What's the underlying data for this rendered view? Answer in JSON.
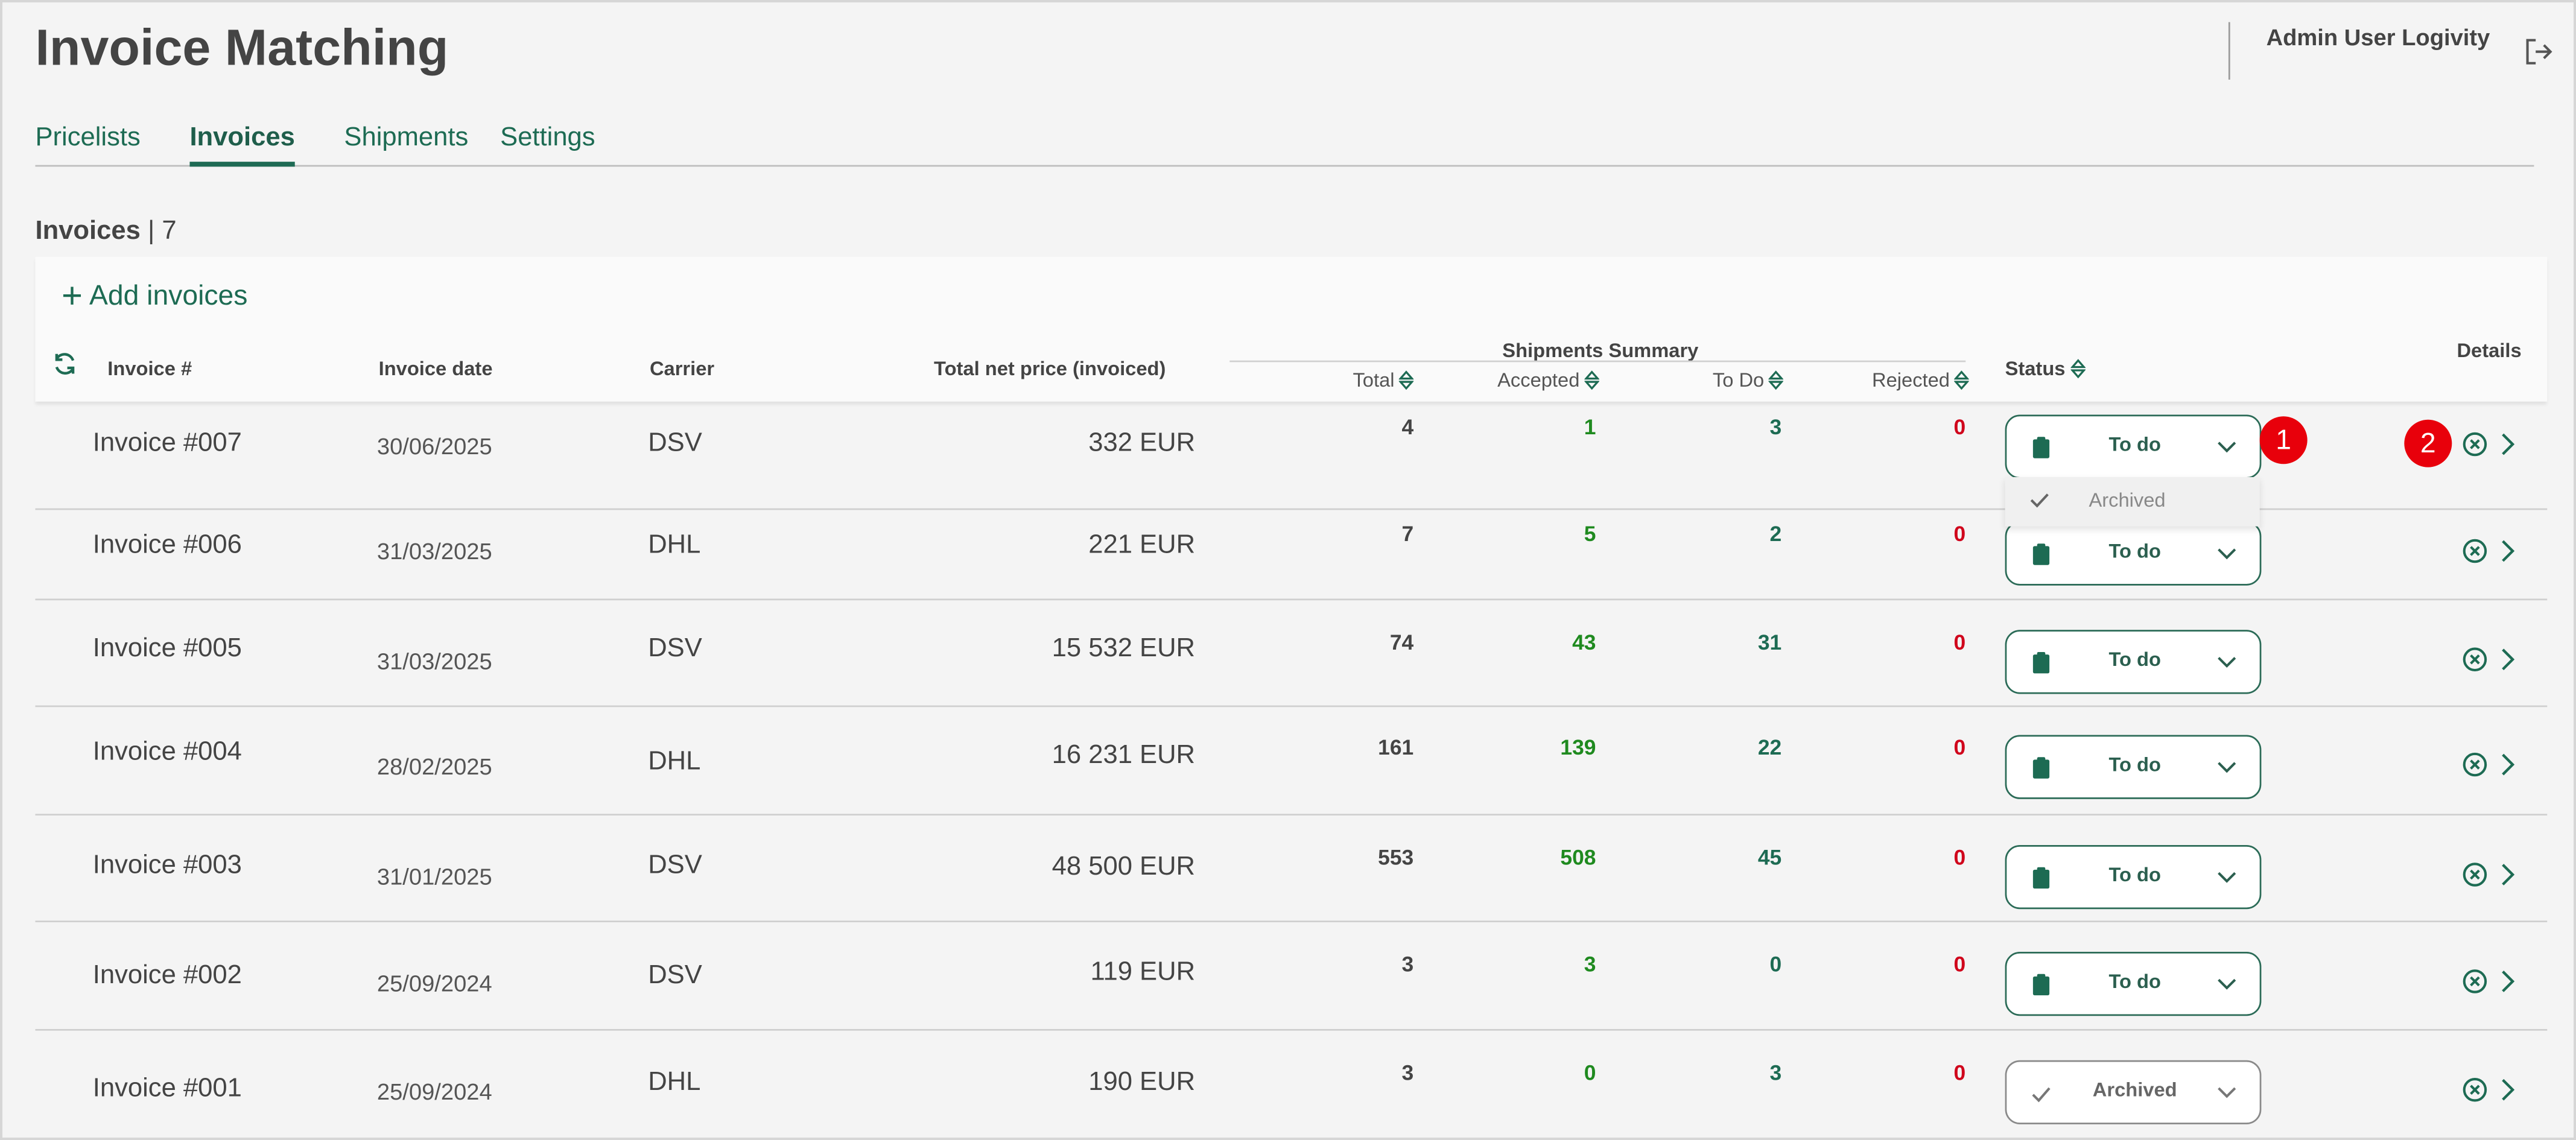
{
  "app": {
    "title": "Invoice Matching",
    "user_name": "Admin User Logivity"
  },
  "tabs": [
    {
      "label": "Pricelists",
      "active": false
    },
    {
      "label": "Invoices",
      "active": true
    },
    {
      "label": "Shipments",
      "active": false
    },
    {
      "label": "Settings",
      "active": false
    }
  ],
  "list": {
    "heading": "Invoices",
    "separator": "|",
    "count": "7",
    "add_label": "Add invoices"
  },
  "columns": {
    "invoice": "Invoice #",
    "date": "Invoice date",
    "carrier": "Carrier",
    "price": "Total net price (invoiced)",
    "summary": "Shipments Summary",
    "total": "Total",
    "accepted": "Accepted",
    "todo": "To Do",
    "rejected": "Rejected",
    "status": "Status",
    "details": "Details"
  },
  "rows": [
    {
      "invoice": "Invoice #007",
      "date": "30/06/2025",
      "carrier": "DSV",
      "price": "332 EUR",
      "total": "4",
      "accepted": "1",
      "todo": "3",
      "rejected": "0",
      "status": "To do"
    },
    {
      "invoice": "Invoice #006",
      "date": "31/03/2025",
      "carrier": "DHL",
      "price": "221 EUR",
      "total": "7",
      "accepted": "5",
      "todo": "2",
      "rejected": "0",
      "status": "To do"
    },
    {
      "invoice": "Invoice #005",
      "date": "31/03/2025",
      "carrier": "DSV",
      "price": "15 532 EUR",
      "total": "74",
      "accepted": "43",
      "todo": "31",
      "rejected": "0",
      "status": "To do"
    },
    {
      "invoice": "Invoice #004",
      "date": "28/02/2025",
      "carrier": "DHL",
      "price": "16 231 EUR",
      "total": "161",
      "accepted": "139",
      "todo": "22",
      "rejected": "0",
      "status": "To do"
    },
    {
      "invoice": "Invoice #003",
      "date": "31/01/2025",
      "carrier": "DSV",
      "price": "48 500 EUR",
      "total": "553",
      "accepted": "508",
      "todo": "45",
      "rejected": "0",
      "status": "To do"
    },
    {
      "invoice": "Invoice #002",
      "date": "25/09/2024",
      "carrier": "DSV",
      "price": "119 EUR",
      "total": "3",
      "accepted": "3",
      "todo": "0",
      "rejected": "0",
      "status": "To do"
    },
    {
      "invoice": "Invoice #001",
      "date": "25/09/2024",
      "carrier": "DHL",
      "price": "190 EUR",
      "total": "3",
      "accepted": "0",
      "todo": "3",
      "rejected": "0",
      "status": "Archived"
    }
  ],
  "dropdown": {
    "option": "Archived"
  },
  "annotations": {
    "badge1": "1",
    "badge2": "2"
  },
  "colors": {
    "brand_green": "#1d6b53",
    "accepted_green": "#1f8a1f",
    "rejected_red": "#d0021b",
    "badge_red": "#e8000b"
  },
  "icons": {
    "refresh": "refresh-icon",
    "logout": "logout-icon",
    "status_todo": "clipboard-icon",
    "status_archived": "check-icon",
    "row_reject": "close-circle-icon",
    "row_open": "chevron-right-icon"
  }
}
